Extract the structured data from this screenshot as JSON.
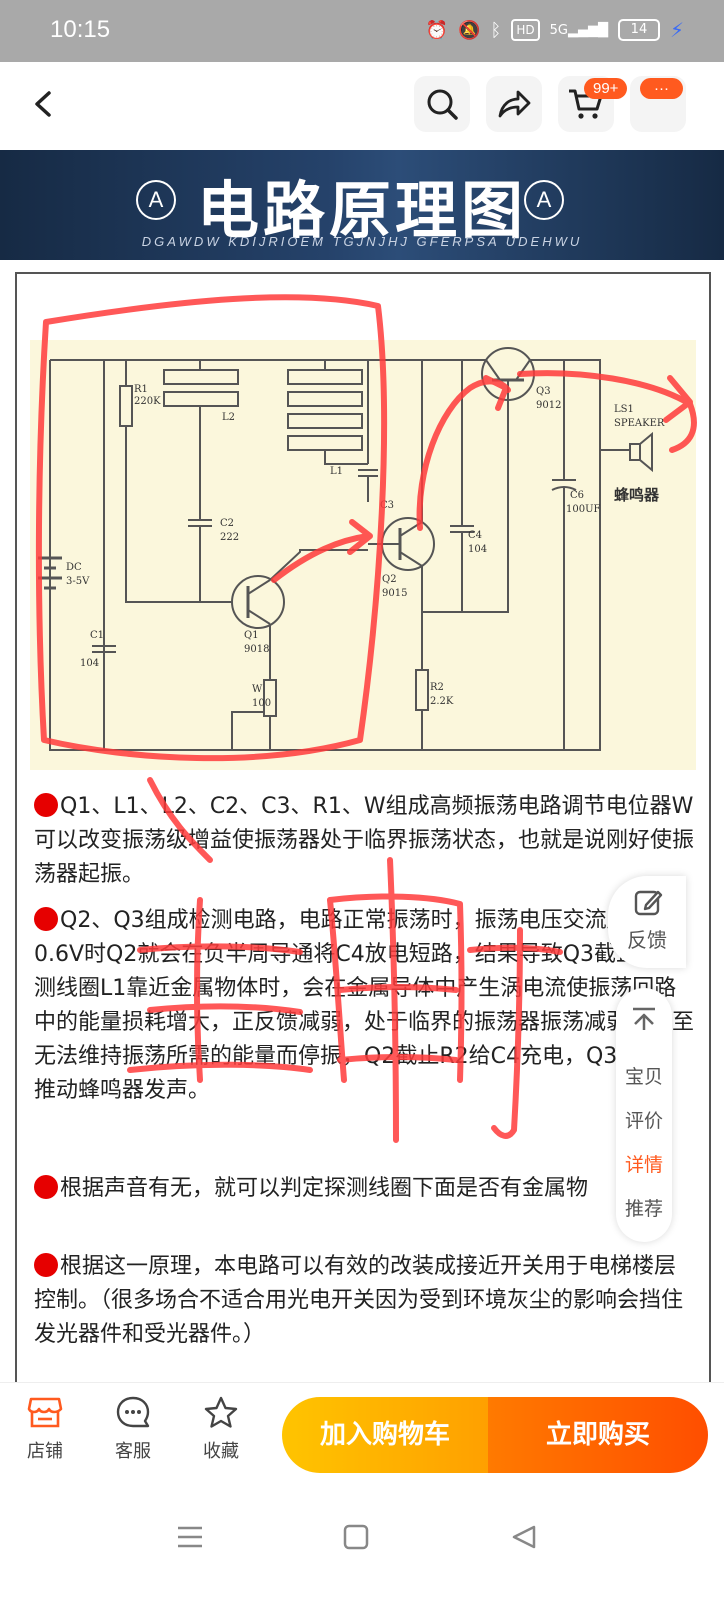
{
  "status_bar": {
    "time": "10:15",
    "hd_label": "HD",
    "network_label": "5G",
    "battery_level": "14"
  },
  "top_nav": {
    "cart_badge": "99+",
    "more_badge": "···"
  },
  "banner": {
    "title": "电路原理图",
    "subtitle": "DGAWDW KDIJRIOEM TGJNJHJ GFERPSA UDEHWU",
    "emblem_letter": "A"
  },
  "circuit": {
    "labels": {
      "r1": "R1",
      "r1_val": "220K",
      "l2": "L2",
      "l1": "L1",
      "c2": "C2",
      "c2_val": "222",
      "c3": "C3",
      "dc": "DC",
      "dc_val": "3-5V",
      "c1": "C1",
      "c1_val": "104",
      "q1": "Q1",
      "q1_val": "9018",
      "w": "W",
      "w_val": "100",
      "q2": "Q2",
      "q2_val": "9015",
      "c4": "C4",
      "c4_val": "104",
      "r2": "R2",
      "r2_val": "2.2K",
      "q3": "Q3",
      "q3_val": "9012",
      "ls1": "LS1",
      "speaker": "SPEAKER",
      "c6": "C6",
      "c6_val": "100UF",
      "buzzer": "蜂鸣器"
    }
  },
  "article": {
    "p1": "Q1、L1、L2、C2、C3、R1、W组成高频振荡电路调节电位器W可以改变振荡级增益使振荡器处于临界振荡状态，也就是说刚好使振荡器起振。",
    "p2": "Q2、Q3组成检测电路，电路正常振荡时，振荡电压交流压超过0.6V时Q2就会在负半周导通将C4放电短路，结果导致Q3截止当探测线圈L1靠近金属物体时，会在金属导体中产生涡电流使振荡回路中的能量损耗增大，正反馈减弱，处于临界的振荡器振荡减弱，甚至无法维持振荡所需的能量而停振，Q2截止R2给C4充电，Q3导通，推动蜂鸣器发声。",
    "p3": "根据声音有无，就可以判定探测线圈下面是否有金属物",
    "p4": "根据这一原理，本电路可以有效的改装成接近开关用于电梯楼层控制。（很多场合不适合用光电开关因为受到环境灰尘的影响会挡住发光器件和受光器件。）"
  },
  "side": {
    "feedback": "反馈",
    "menu": [
      "宝贝",
      "评价",
      "详情",
      "推荐"
    ],
    "active": "详情"
  },
  "bottom_bar": {
    "shop": "店铺",
    "service": "客服",
    "favorite": "收藏",
    "add_to_cart": "加入购物车",
    "buy_now": "立即购买"
  },
  "colors": {
    "accent": "#ff5a1f",
    "cart_button": "#ffb300",
    "buy_button": "#ff5a00",
    "annotation_red": "#ff3b3b"
  }
}
